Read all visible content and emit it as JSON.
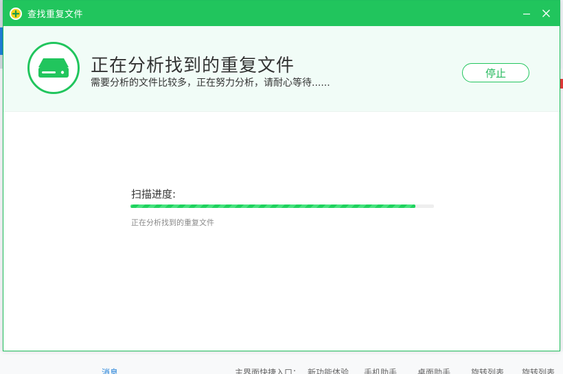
{
  "window": {
    "title": "查找重复文件",
    "minimize_label": "—",
    "close_label": "✕"
  },
  "header": {
    "title": "正在分析找到的重复文件",
    "subtitle": "需要分析的文件比较多，正在努力分析，请耐心等待......",
    "stop_label": "停止",
    "icon": "hard-disk-icon"
  },
  "progress": {
    "label": "扫描进度:",
    "value_percent": 94,
    "detail": "正在分析找到的重复文件"
  },
  "background": {
    "bottom_texts": [
      "消息",
      "主界面快捷入口：",
      "新功能体验",
      "手机助手",
      "桌面助手",
      "旋转列表",
      "旋转列表"
    ]
  },
  "colors": {
    "accent": "#21c55d",
    "header_bg": "#f1fcf7",
    "text": "#333333"
  }
}
